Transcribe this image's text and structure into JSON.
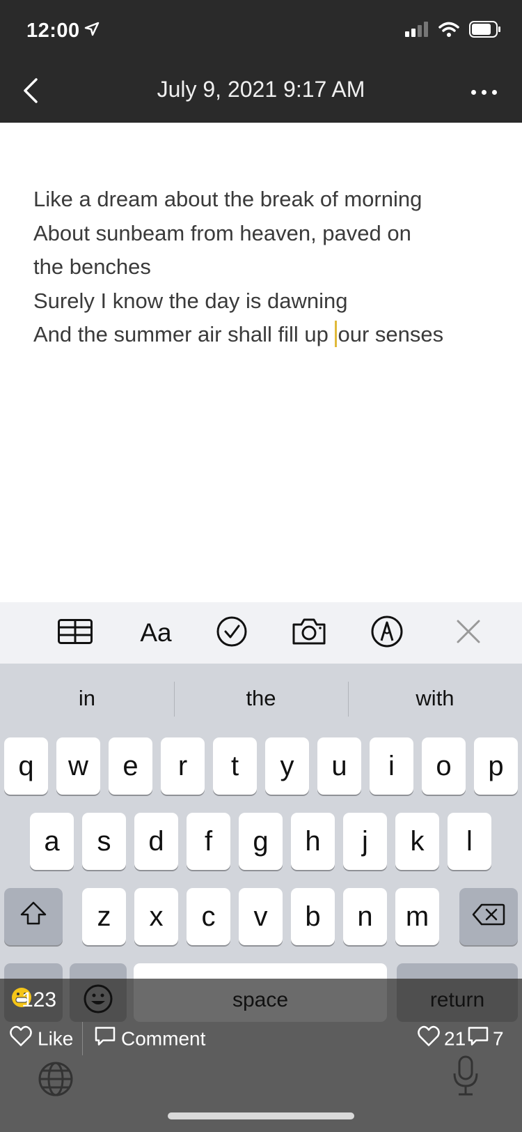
{
  "status_bar": {
    "time": "12:00",
    "signal_icon": "cellular-signal-icon",
    "wifi_icon": "wifi-icon",
    "battery_icon": "battery-icon"
  },
  "nav": {
    "title": "July 9, 2021 9:17 AM",
    "back_icon": "chevron-left-icon",
    "more_icon": "more-dots-icon"
  },
  "note": {
    "line1": "Like a dream about the break of morning",
    "line2": "About sunbeam from heaven, paved on",
    "line3": "the benches",
    "line4": "Surely I know the day is dawning",
    "line5_before": "And the summer air shall fill up ",
    "line5_after": "our senses",
    "cursor_color": "#e0b93a"
  },
  "toolbar": {
    "table_icon": "table-icon",
    "format_label": "Aa",
    "checklist_icon": "checklist-icon",
    "camera_icon": "camera-icon",
    "markup_icon": "pen-markup-icon",
    "close_icon": "close-icon"
  },
  "keyboard": {
    "suggestions": [
      "in",
      "the",
      "with"
    ],
    "row1": [
      "q",
      "w",
      "e",
      "r",
      "t",
      "y",
      "u",
      "i",
      "o",
      "p"
    ],
    "row2": [
      "a",
      "s",
      "d",
      "f",
      "g",
      "h",
      "j",
      "k",
      "l"
    ],
    "row3": [
      "z",
      "x",
      "c",
      "v",
      "b",
      "n",
      "m"
    ],
    "numbers_label": "123",
    "space_label": "space",
    "return_label": "return"
  },
  "overlay": {
    "like_label": "Like",
    "comment_label": "Comment",
    "like_count": "21",
    "comment_count": "7"
  }
}
